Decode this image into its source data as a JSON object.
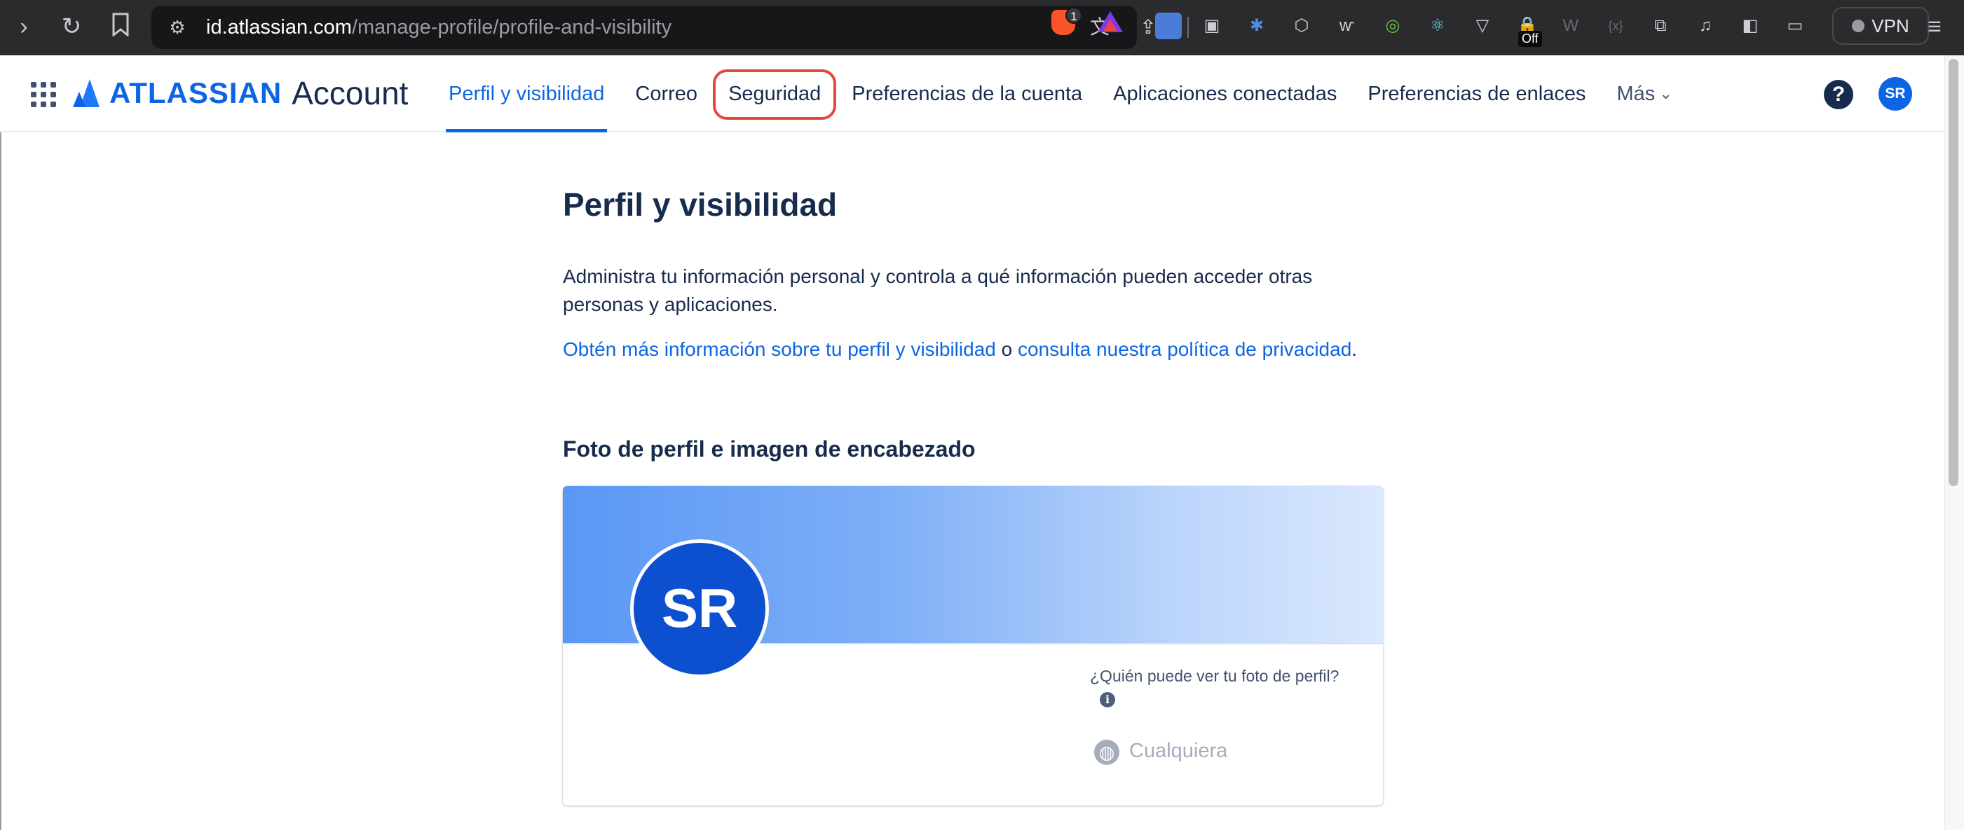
{
  "browser": {
    "url_host": "id.atlassian.com",
    "url_path": "/manage-profile/profile-and-visibility",
    "brave_badge_count": "1",
    "extension_off_badge": "Off",
    "vpn_label": "VPN",
    "icons": [
      "forward-icon",
      "reload-icon",
      "bookmark-icon",
      "tune-icon",
      "translate-icon",
      "share-icon",
      "brave-shield-icon",
      "brave-rewards-icon",
      "extensions-icon",
      "music-icon",
      "sidebar-icon",
      "wallet-icon",
      "menu-icon"
    ]
  },
  "header": {
    "logo_text": "ATLASSIAN",
    "logo_sub": "Account",
    "tabs": [
      {
        "label": "Perfil y visibilidad",
        "active": true
      },
      {
        "label": "Correo",
        "active": false
      },
      {
        "label": "Seguridad",
        "active": false,
        "highlighted": true
      },
      {
        "label": "Preferencias de la cuenta",
        "active": false
      },
      {
        "label": "Aplicaciones conectadas",
        "active": false
      },
      {
        "label": "Preferencias de enlaces",
        "active": false
      },
      {
        "label": "Más",
        "active": false
      }
    ],
    "help_label": "?",
    "avatar_initials": "SR"
  },
  "main": {
    "title": "Perfil y visibilidad",
    "description": "Administra tu información personal y controla a qué información pueden acceder otras personas y aplicaciones.",
    "link_learn_more": "Obtén más información sobre tu perfil y visibilidad",
    "connector": "o",
    "link_privacy": "consulta nuestra política de privacidad",
    "period": ".",
    "section_title": "Foto de perfil e imagen de encabezado",
    "profile_card": {
      "avatar_initials": "SR",
      "who_can_see": "¿Quién puede ver tu foto de perfil?",
      "visibility_value": "Cualquiera"
    }
  },
  "colors": {
    "accent": "#0c66e4",
    "highlight_ring": "#e2483d",
    "text": "#172b4d"
  }
}
